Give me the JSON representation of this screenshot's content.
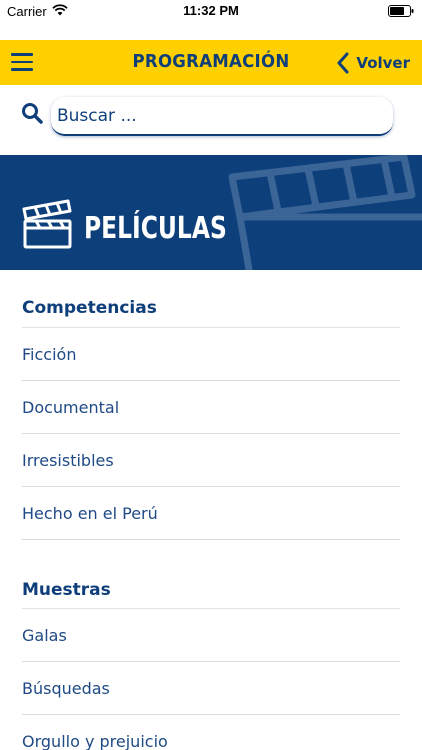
{
  "status_bar": {
    "carrier": "Carrier",
    "time": "11:32 PM"
  },
  "header": {
    "title": "PROGRAMACIÓN",
    "back_label": "Volver"
  },
  "search": {
    "placeholder": "Buscar ..."
  },
  "banner": {
    "title": "PELÍCULAS"
  },
  "sections": [
    {
      "title": "Competencias",
      "items": [
        "Ficción",
        "Documental",
        "Irresistibles",
        "Hecho en el Perú"
      ]
    },
    {
      "title": "Muestras",
      "items": [
        "Galas",
        "Búsquedas",
        "Orgullo y prejuicio"
      ]
    }
  ],
  "colors": {
    "brand_yellow": "#fed000",
    "brand_blue": "#0f3f7a",
    "banner_blue": "#0d3f7a"
  },
  "icons": {
    "menu": "hamburger-menu-icon",
    "back": "chevron-left-icon",
    "search": "magnifier-icon",
    "banner": "film-clapperboard-icon"
  }
}
